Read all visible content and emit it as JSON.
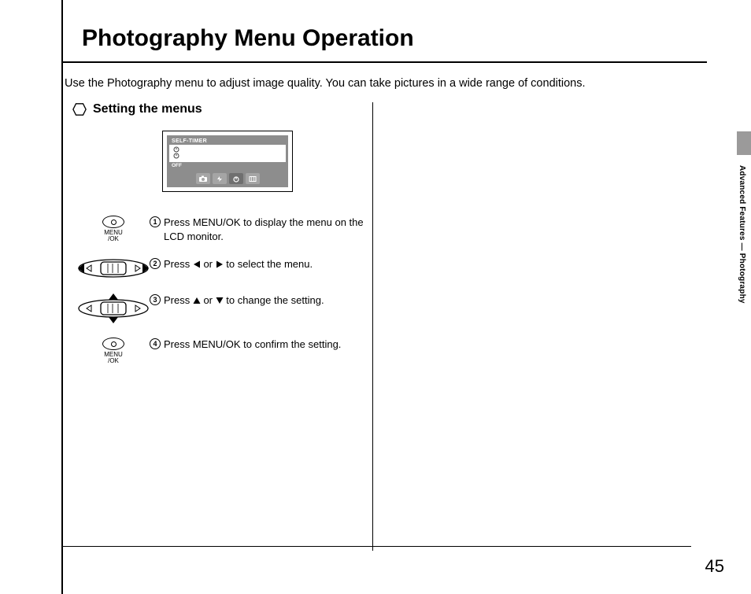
{
  "title": "Photography Menu Operation",
  "intro": "Use the Photography menu to adjust image quality. You can take pictures in a wide range of conditions.",
  "section": {
    "heading": "Setting the menus"
  },
  "lcd": {
    "header": "SELF-TIMER",
    "off": "OFF"
  },
  "steps": [
    {
      "n": "1",
      "text": "Press MENU/OK to display the menu on the LCD monitor."
    },
    {
      "n": "2",
      "pre": "Press ",
      "mid": " or ",
      "post": " to select the menu."
    },
    {
      "n": "3",
      "pre": "Press ",
      "mid": " or ",
      "post": " to change the setting."
    },
    {
      "n": "4",
      "text": "Press MENU/OK to confirm the setting."
    }
  ],
  "menuok": {
    "line1": "MENU",
    "line2": "/OK"
  },
  "side_label": "Advanced Features — Photography",
  "page_number": "45"
}
